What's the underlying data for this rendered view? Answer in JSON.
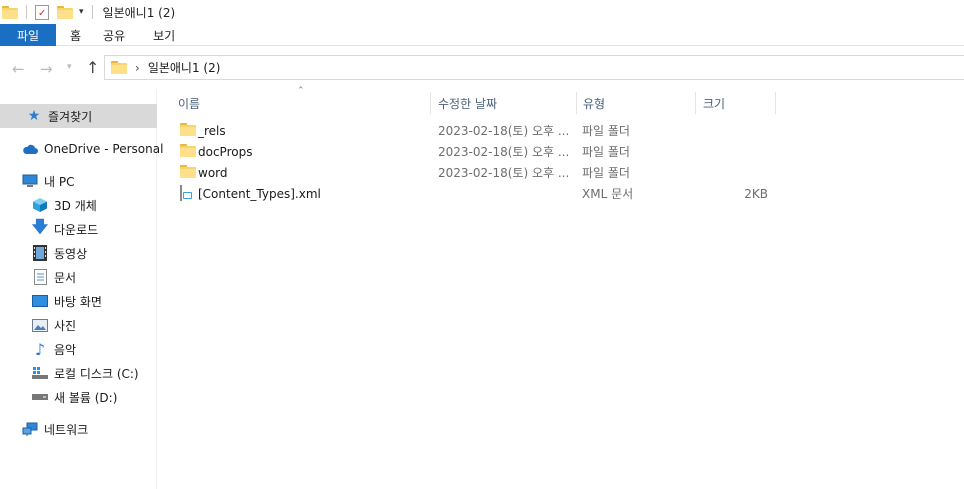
{
  "window": {
    "title": "일본애니1 (2)"
  },
  "ribbon": {
    "tabs": [
      {
        "label": "파일"
      },
      {
        "label": "홈"
      },
      {
        "label": "공유"
      },
      {
        "label": "보기"
      }
    ]
  },
  "address": {
    "path": "일본애니1 (2)"
  },
  "nav": {
    "quick_access": "즐겨찾기",
    "onedrive": "OneDrive - Personal",
    "this_pc": "내 PC",
    "items": [
      {
        "label": "3D 개체",
        "icon": "cube-icon"
      },
      {
        "label": "다운로드",
        "icon": "download-icon"
      },
      {
        "label": "동영상",
        "icon": "video-icon"
      },
      {
        "label": "문서",
        "icon": "document-icon"
      },
      {
        "label": "바탕 화면",
        "icon": "desktop-icon"
      },
      {
        "label": "사진",
        "icon": "picture-icon"
      },
      {
        "label": "음악",
        "icon": "music-icon"
      },
      {
        "label": "로컬 디스크 (C:)",
        "icon": "drive-c-icon"
      },
      {
        "label": "새 볼륨 (D:)",
        "icon": "drive-d-icon"
      }
    ],
    "network": "네트워크"
  },
  "columns": {
    "name": "이름",
    "date": "수정한 날짜",
    "type": "유형",
    "size": "크기"
  },
  "files": [
    {
      "name": "_rels",
      "date": "2023-02-18(토) 오후 ...",
      "type": "파일 폴더",
      "size": "",
      "kind": "folder"
    },
    {
      "name": "docProps",
      "date": "2023-02-18(토) 오후 ...",
      "type": "파일 폴더",
      "size": "",
      "kind": "folder"
    },
    {
      "name": "word",
      "date": "2023-02-18(토) 오후 ...",
      "type": "파일 폴더",
      "size": "",
      "kind": "folder"
    },
    {
      "name": "[Content_Types].xml",
      "date": "",
      "type": "XML 문서",
      "size": "2KB",
      "kind": "xml"
    }
  ],
  "colors": {
    "file_tab": "#1a6fc2",
    "selected": "#d9d9d9",
    "header_text": "#4c607a"
  }
}
